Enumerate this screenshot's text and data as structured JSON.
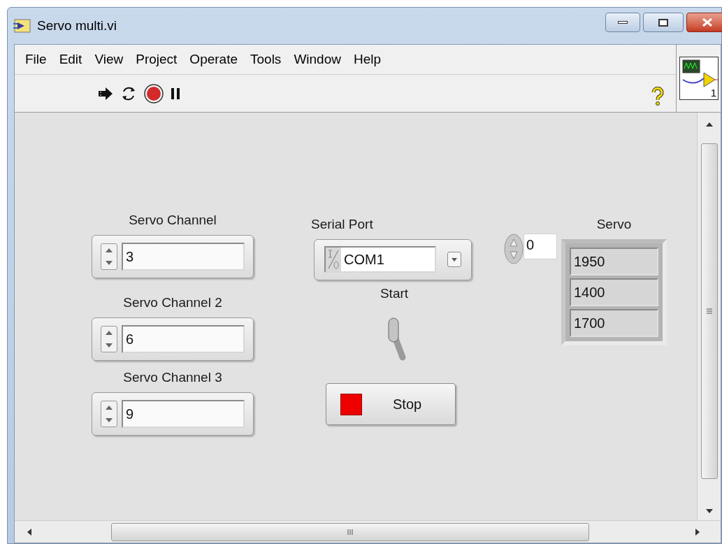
{
  "window": {
    "title": "Servo multi.vi"
  },
  "menu": [
    "File",
    "Edit",
    "View",
    "Project",
    "Operate",
    "Tools",
    "Window",
    "Help"
  ],
  "vi_icon": {
    "label": "1"
  },
  "controls": [
    {
      "kind": "numeric",
      "label": "Servo Channel",
      "value": "3"
    },
    {
      "kind": "numeric",
      "label": "Servo Channel 2",
      "value": "6"
    },
    {
      "kind": "numeric",
      "label": "Servo Channel 3",
      "value": "9"
    },
    {
      "kind": "visa",
      "label": "Serial Port",
      "value": "COM1"
    },
    {
      "kind": "toggle",
      "label": "Start",
      "on": false
    },
    {
      "kind": "stop",
      "label": "Stop"
    },
    {
      "kind": "array",
      "label": "Servo",
      "index": "0",
      "values": [
        "1950",
        "1400",
        "1700"
      ]
    }
  ]
}
